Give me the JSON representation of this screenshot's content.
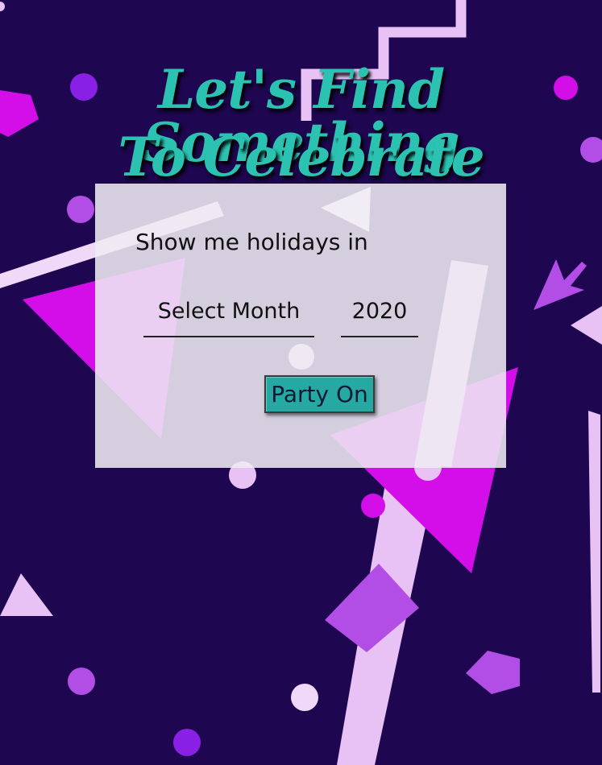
{
  "page": {
    "title_line1": "Let's Find Something",
    "title_line2": "To Celebrate"
  },
  "form": {
    "prompt": "Show me holidays in",
    "month_select": {
      "value": "Select Month"
    },
    "year_select": {
      "value": "2020"
    },
    "submit_label": "Party On"
  },
  "colors": {
    "background": "#1e0650",
    "title": "#2bc2b2",
    "button": "#26a9a3",
    "card": "#eeeaf3",
    "shape_magenta": "#d40ee8",
    "shape_violet": "#b24de6",
    "shape_pale": "#e8c2f5"
  }
}
